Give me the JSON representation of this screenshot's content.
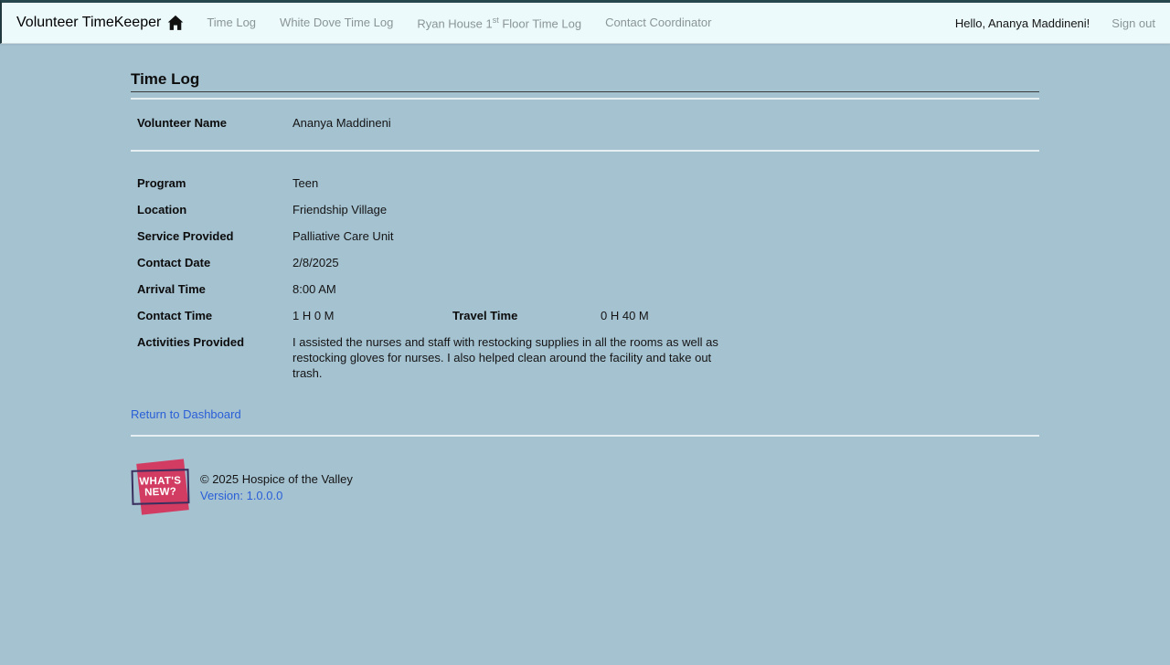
{
  "nav": {
    "brand": "Volunteer TimeKeeper",
    "home_icon": "house-icon",
    "time_log": "Time Log",
    "white_dove": "White Dove Time Log",
    "ryan_pre": "Ryan House 1",
    "ryan_sup": "st",
    "ryan_post": " Floor Time Log",
    "contact_coordinator": "Contact Coordinator",
    "greeting": "Hello, Ananya Maddineni!",
    "sign_out": "Sign out"
  },
  "page": {
    "title": "Time Log",
    "fields": {
      "volunteer_name": {
        "label": "Volunteer Name",
        "value": "Ananya Maddineni"
      },
      "program": {
        "label": "Program",
        "value": "Teen"
      },
      "location": {
        "label": "Location",
        "value": "Friendship Village"
      },
      "service_provided": {
        "label": "Service Provided",
        "value": "Palliative Care Unit"
      },
      "contact_date": {
        "label": "Contact Date",
        "value": "2/8/2025"
      },
      "arrival_time": {
        "label": "Arrival Time",
        "value": "8:00 AM"
      },
      "contact_time": {
        "label": "Contact Time",
        "value": "1 H 0 M"
      },
      "travel_time": {
        "label": "Travel Time",
        "value": "0 H 40 M"
      },
      "activities_provided": {
        "label": "Activities Provided",
        "value": "I assisted the nurses and staff with restocking supplies in all the rooms as well as restocking gloves for nurses. I also helped clean around the facility and take out trash."
      }
    },
    "return_link": "Return to Dashboard"
  },
  "footer": {
    "whats_new_line1": "WHAT'S",
    "whats_new_line2": "NEW?",
    "copyright": "© 2025 Hospice of the Valley",
    "version": "Version: 1.0.0.0"
  },
  "colors": {
    "page_background": "#a5c2d1",
    "navbar_background": "#ecfafb",
    "link_blue": "#2a5fd7",
    "badge_pink": "#d23c62",
    "badge_navy": "#392f5e",
    "nav_link_gray": "#8a9598"
  }
}
